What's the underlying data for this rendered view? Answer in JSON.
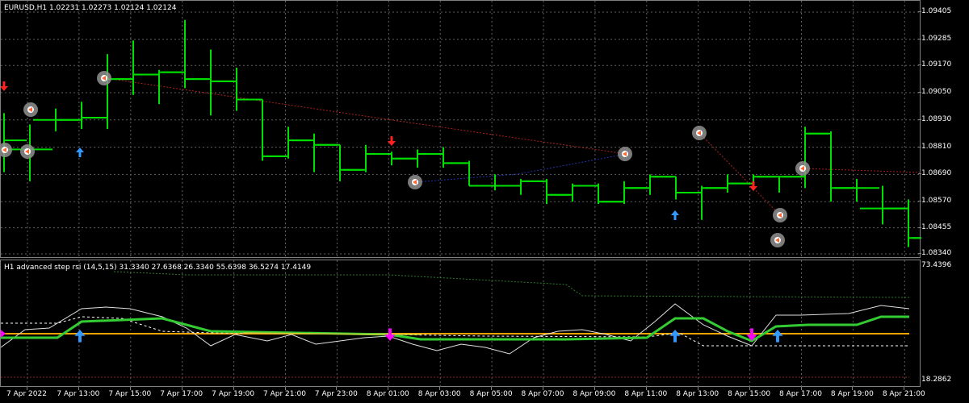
{
  "main_chart": {
    "title": "EURUSD,H1  1.02231 1.02273 1.02124 1.02124",
    "price_labels": [
      "1.09405",
      "1.09285",
      "1.09170",
      "1.09050",
      "1.08930",
      "1.08810",
      "1.08690",
      "1.08570",
      "1.08455",
      "1.08340"
    ]
  },
  "indicator": {
    "title": "H1 advanced step rsi (14,5,15) 31.3340 27.6368 26.3340 55.6398 36.5274 17.4149",
    "max_label": "73.4396",
    "min_label": "18.2862"
  },
  "time_labels": [
    "7 Apr 2022",
    "7 Apr 13:00",
    "7 Apr 15:00",
    "7 Apr 17:00",
    "7 Apr 19:00",
    "7 Apr 21:00",
    "7 Apr 23:00",
    "8 Apr 01:00",
    "8 Apr 03:00",
    "8 Apr 05:00",
    "8 Apr 07:00",
    "8 Apr 09:00",
    "8 Apr 11:00",
    "8 Apr 13:00",
    "8 Apr 15:00",
    "8 Apr 17:00",
    "8 Apr 19:00",
    "8 Apr 21:00"
  ],
  "colors": {
    "bars": "#00e000",
    "grid": "#606060",
    "up_arrow": "#3399ff",
    "down_arrow": "#ff2020",
    "magenta": "#ff00ff",
    "rsi": "#33cc33",
    "level": "#ffa500"
  },
  "chart_data": {
    "type": "ohlc",
    "ylim": [
      1.0834,
      1.09405
    ],
    "bars": [
      {
        "o": 1.088,
        "h": 1.0896,
        "l": 1.087,
        "c": 1.0884
      },
      {
        "o": 1.088,
        "h": 1.0891,
        "l": 1.0866,
        "c": 1.088
      },
      {
        "o": 1.0893,
        "h": 1.0898,
        "l": 1.0888,
        "c": 1.0893
      },
      {
        "o": 1.0893,
        "h": 1.0901,
        "l": 1.0889,
        "c": 1.0894
      },
      {
        "o": 1.0894,
        "h": 1.0922,
        "l": 1.0889,
        "c": 1.0911
      },
      {
        "o": 1.0911,
        "h": 1.0928,
        "l": 1.0904,
        "c": 1.0913
      },
      {
        "o": 1.0913,
        "h": 1.0915,
        "l": 1.09,
        "c": 1.0914
      },
      {
        "o": 1.0914,
        "h": 1.0937,
        "l": 1.0907,
        "c": 1.0911
      },
      {
        "o": 1.0911,
        "h": 1.0924,
        "l": 1.0895,
        "c": 1.091
      },
      {
        "o": 1.091,
        "h": 1.0916,
        "l": 1.0897,
        "c": 1.0902
      },
      {
        "o": 1.0902,
        "h": 1.0902,
        "l": 1.0875,
        "c": 1.0877
      },
      {
        "o": 1.0877,
        "h": 1.089,
        "l": 1.0876,
        "c": 1.0884
      },
      {
        "o": 1.0884,
        "h": 1.0887,
        "l": 1.087,
        "c": 1.0882
      },
      {
        "o": 1.0882,
        "h": 1.0882,
        "l": 1.0866,
        "c": 1.0871
      },
      {
        "o": 1.0871,
        "h": 1.0882,
        "l": 1.087,
        "c": 1.0878
      },
      {
        "o": 1.0878,
        "h": 1.0879,
        "l": 1.0873,
        "c": 1.0876
      },
      {
        "o": 1.0876,
        "h": 1.088,
        "l": 1.0872,
        "c": 1.0878
      },
      {
        "o": 1.0878,
        "h": 1.0881,
        "l": 1.0872,
        "c": 1.0874
      },
      {
        "o": 1.0874,
        "h": 1.0875,
        "l": 1.0864,
        "c": 1.0864
      },
      {
        "o": 1.0864,
        "h": 1.0869,
        "l": 1.0862,
        "c": 1.0864
      },
      {
        "o": 1.0864,
        "h": 1.0867,
        "l": 1.086,
        "c": 1.0866
      },
      {
        "o": 1.0866,
        "h": 1.0867,
        "l": 1.0856,
        "c": 1.086
      },
      {
        "o": 1.086,
        "h": 1.0865,
        "l": 1.0857,
        "c": 1.0864
      },
      {
        "o": 1.0864,
        "h": 1.0865,
        "l": 1.0856,
        "c": 1.0857
      },
      {
        "o": 1.0857,
        "h": 1.0866,
        "l": 1.0856,
        "c": 1.0863
      },
      {
        "o": 1.0863,
        "h": 1.0869,
        "l": 1.086,
        "c": 1.0868
      },
      {
        "o": 1.0868,
        "h": 1.0868,
        "l": 1.0858,
        "c": 1.0861
      },
      {
        "o": 1.0861,
        "h": 1.0864,
        "l": 1.0849,
        "c": 1.0863
      },
      {
        "o": 1.0863,
        "h": 1.0869,
        "l": 1.0861,
        "c": 1.0865
      },
      {
        "o": 1.0865,
        "h": 1.0869,
        "l": 1.0862,
        "c": 1.0868
      },
      {
        "o": 1.0868,
        "h": 1.0868,
        "l": 1.0861,
        "c": 1.0868
      },
      {
        "o": 1.0868,
        "h": 1.089,
        "l": 1.0863,
        "c": 1.0887
      },
      {
        "o": 1.0887,
        "h": 1.0888,
        "l": 1.0857,
        "c": 1.0863
      },
      {
        "o": 1.0863,
        "h": 1.0867,
        "l": 1.0857,
        "c": 1.0863
      },
      {
        "o": 1.0854,
        "h": 1.0864,
        "l": 1.0847,
        "c": 1.0854
      },
      {
        "o": 1.0854,
        "h": 1.0858,
        "l": 1.0837,
        "c": 1.0841
      },
      {
        "o": 1.0841,
        "h": 1.0881,
        "l": 1.084,
        "c": 1.0873
      },
      {
        "o": 1.0873,
        "h": 1.0881,
        "l": 1.0868,
        "c": 1.0873
      },
      {
        "o": 1.0873,
        "h": 1.0874,
        "l": 1.087,
        "c": 1.0871
      },
      {
        "o": 1.0871,
        "h": 1.0874,
        "l": 1.0866,
        "c": 1.0872
      },
      {
        "o": 1.0872,
        "h": 1.0873,
        "l": 1.0867,
        "c": 1.0871
      },
      {
        "o": 1.0871,
        "h": 1.0886,
        "l": 1.0869,
        "c": 1.0884
      },
      {
        "o": 1.0884,
        "h": 1.0885,
        "l": 1.0877,
        "c": 1.0878
      }
    ],
    "indicator_ylim": [
      18.2862,
      73.4396
    ]
  }
}
